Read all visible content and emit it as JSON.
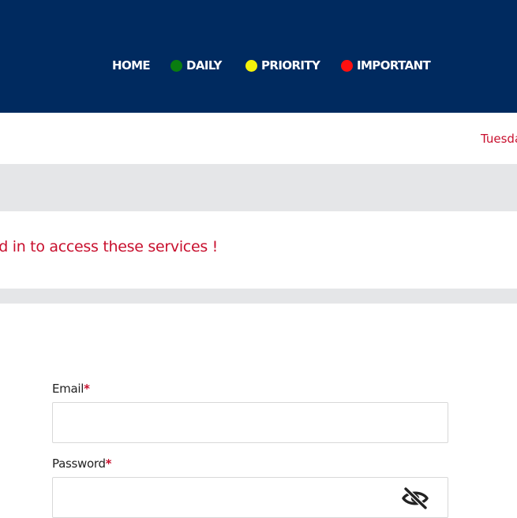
{
  "nav": {
    "items": [
      {
        "label": "HOME",
        "dot": null
      },
      {
        "label": "DAILY",
        "dot": "#0a7d10"
      },
      {
        "label": "PRIORITY",
        "dot": "#f5f20a"
      },
      {
        "label": "IMPORTANT",
        "dot": "#ff1010"
      }
    ]
  },
  "date": "Tuesda",
  "notice": "ned in to access these services !",
  "form": {
    "email_label": "Email",
    "password_label": "Password",
    "required_mark": "*",
    "email_value": "",
    "password_value": ""
  },
  "icons": {
    "password_toggle": "eye-slash-icon"
  },
  "colors": {
    "header_bg": "#002a5f",
    "accent_red": "#c8102e",
    "gray_band": "#e5e6e8"
  }
}
